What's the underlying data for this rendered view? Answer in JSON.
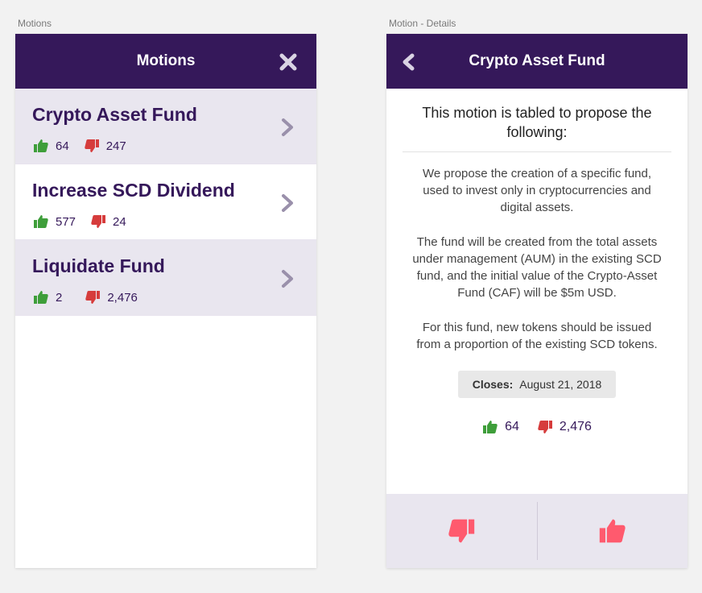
{
  "frames": {
    "left_label": "Motions",
    "right_label": "Motion - Details"
  },
  "motions_screen": {
    "title": "Motions",
    "close_icon": "close-icon",
    "items": [
      {
        "title": "Crypto Asset Fund",
        "up": "64",
        "down": "247"
      },
      {
        "title": "Increase SCD Dividend",
        "up": "577",
        "down": "24"
      },
      {
        "title": "Liquidate Fund",
        "up": "2",
        "down": "2,476"
      }
    ]
  },
  "details_screen": {
    "title": "Crypto Asset Fund",
    "heading": "This motion is tabled to propose the following:",
    "paragraphs": [
      "We propose the creation of a specific fund, used to invest only in cryptocurrencies and digital assets.",
      "The fund will be created from the total assets under management (AUM) in the existing SCD fund, and the initial value of the Crypto-Asset Fund (CAF) will be $5m USD.",
      "For this fund, new tokens should be issued from a proportion of the existing SCD tokens."
    ],
    "closes_label": "Closes:",
    "closes_date": "August 21, 2018",
    "votes_up": "64",
    "votes_down": "2,476"
  },
  "colors": {
    "brand": "#35185a",
    "thumb_up": "#3e9e3a",
    "thumb_down": "#d63c3c",
    "action_thumb": "#ff5a6e"
  }
}
